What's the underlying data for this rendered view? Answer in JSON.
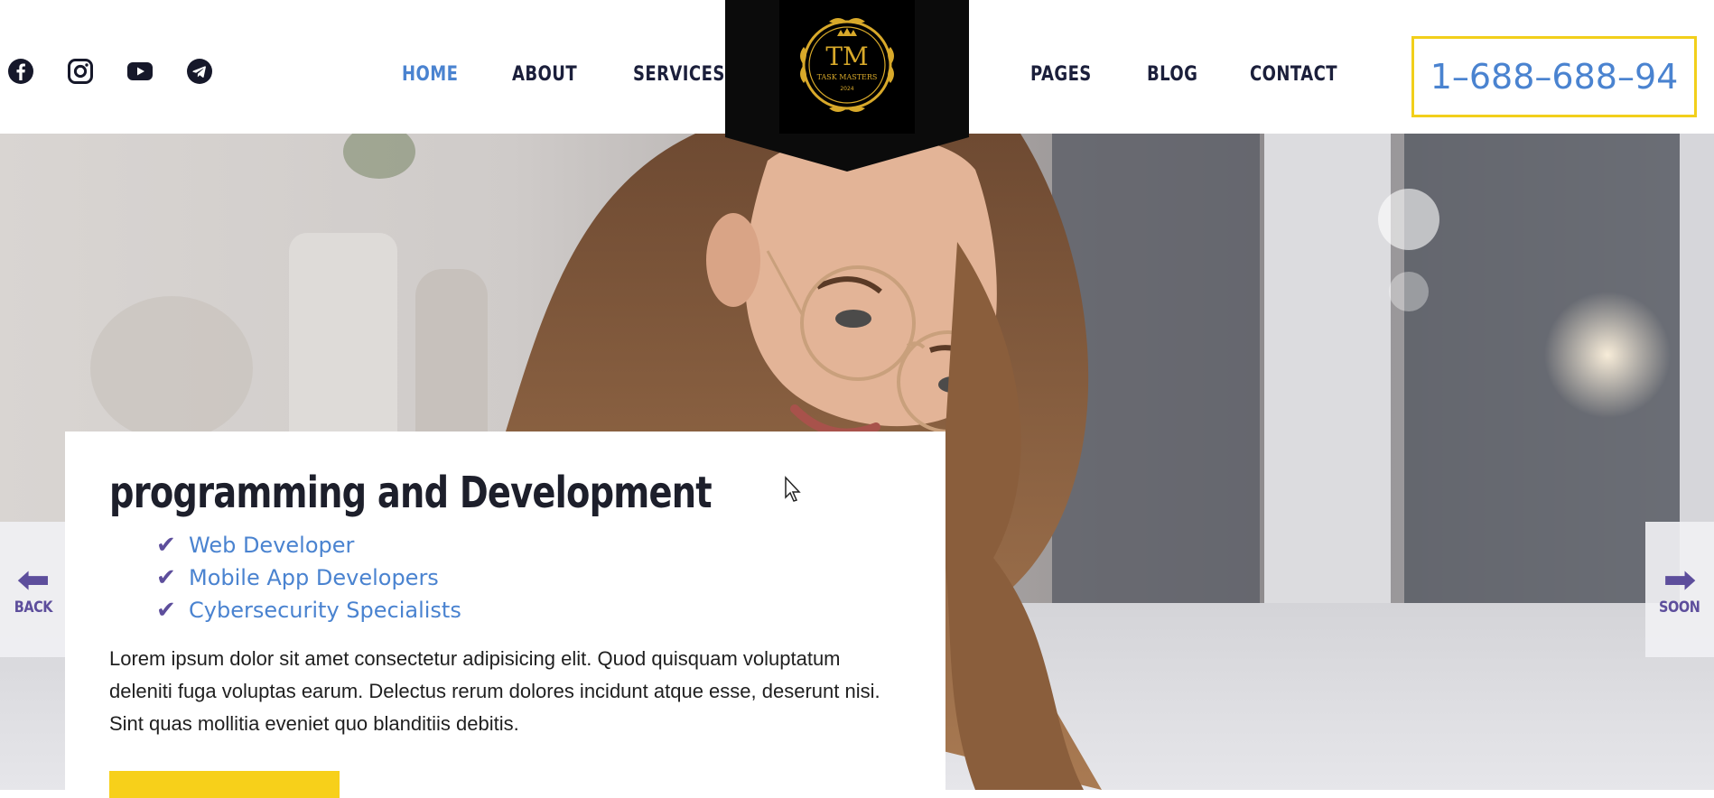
{
  "header": {
    "social": [
      {
        "name": "facebook-icon"
      },
      {
        "name": "instagram-icon"
      },
      {
        "name": "youtube-icon"
      },
      {
        "name": "telegram-icon"
      }
    ],
    "nav_left": [
      {
        "label": "HOME",
        "active": true
      },
      {
        "label": "ABOUT",
        "active": false
      },
      {
        "label": "SERVICES",
        "active": false
      }
    ],
    "nav_right": [
      {
        "label": "PAGES",
        "active": false
      },
      {
        "label": "BLOG",
        "active": false
      },
      {
        "label": "CONTACT",
        "active": false
      }
    ],
    "logo": {
      "monogram": "TM",
      "brand": "TASK MASTERS",
      "year": "2024"
    },
    "phone": "1–688–688–94"
  },
  "hero": {
    "back_label": "BACK",
    "next_label": "SOON",
    "card": {
      "title": "programming and Development",
      "list": [
        "Web Developer",
        "Mobile App Developers",
        "Cybersecurity Specialists"
      ],
      "body": "Lorem ipsum dolor sit amet consectetur adipisicing elit. Quod quisquam voluptatum deleniti fuga voluptas earum. Delectus rerum dolores incidunt atque esse, deserunt nisi. Sint quas mollitia eveniet quo blanditiis debitis."
    }
  },
  "colors": {
    "accent_blue": "#4a83d0",
    "accent_yellow": "#f2cf1a",
    "accent_purple": "#5d4e9c",
    "dark_text": "#1b1f3b",
    "logo_gold": "#d8a92a"
  }
}
